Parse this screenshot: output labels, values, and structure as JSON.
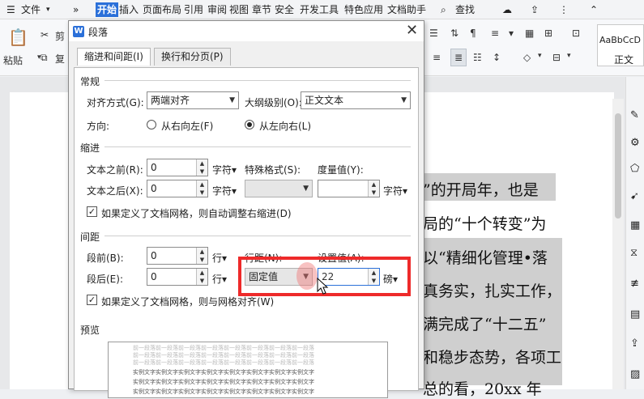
{
  "menubar": {
    "file_label": "文件",
    "more_label": "»",
    "tabs": [
      "开始",
      "插入",
      "页面布局",
      "引用",
      "审阅",
      "视图",
      "章节",
      "安全",
      "开发工具",
      "特色应用",
      "文档助手"
    ],
    "active_tab": "开始",
    "search_label": "查找"
  },
  "ribbon": {
    "paste_label": "粘贴",
    "cut_label": "剪",
    "copy_label": "复",
    "style_preview": "AaBbCcD",
    "style_name": "正文"
  },
  "document": {
    "lines": [
      "”的开局年，也是",
      "局的“十个转变”为",
      "以“精细化管理•落",
      "真务实，扎实工作，",
      "满完成了“十二五”",
      "和稳步态势，各项工",
      "总的看，20xx 年"
    ]
  },
  "dialog": {
    "title": "段落",
    "close_label": "✕",
    "tabs": [
      {
        "label": "缩进和间距(I)",
        "selected": true
      },
      {
        "label": "换行和分页(P)",
        "selected": false
      }
    ],
    "general": {
      "section_label": "常规",
      "alignment_label": "对齐方式(G):",
      "alignment_value": "两端对齐",
      "outline_label": "大纲级别(O):",
      "outline_value": "正文文本",
      "direction_label": "方向:",
      "direction_options": [
        {
          "label": "从右向左(F)",
          "selected": false
        },
        {
          "label": "从左向右(L)",
          "selected": true
        }
      ]
    },
    "indent": {
      "section_label": "缩进",
      "before_label": "文本之前(R):",
      "before_value": "0",
      "before_unit": "字符▾",
      "after_label": "文本之后(X):",
      "after_value": "0",
      "after_unit": "字符▾",
      "special_label": "特殊格式(S):",
      "special_value": "",
      "measure_label": "度量值(Y):",
      "measure_value": "",
      "measure_unit": "字符▾",
      "grid_checkbox_label": "如果定义了文档网格，则自动调整右缩进(D)",
      "grid_checked": true
    },
    "spacing": {
      "section_label": "间距",
      "before_label": "段前(B):",
      "before_value": "0",
      "before_unit": "行▾",
      "after_label": "段后(E):",
      "after_value": "0",
      "after_unit": "行▾",
      "line_spacing_label": "行距(N):",
      "line_spacing_value": "固定值",
      "set_value_label": "设置值(A):",
      "set_value": "22",
      "set_value_unit": "磅▾",
      "grid_checkbox_label": "如果定义了文档网格，则与网格对齐(W)",
      "grid_checked": true
    },
    "preview": {
      "section_label": "预览",
      "prev_text": "前一段落前一段落前一段落前一段落前一段落前一段落前一段落前一段落",
      "sample_text": "实例文字实例文字实例文字实例文字实例文字实例文字实例文字实例文字"
    }
  },
  "colors": {
    "accent": "#2b70d9",
    "highlight_box": "#ee2a2a"
  }
}
